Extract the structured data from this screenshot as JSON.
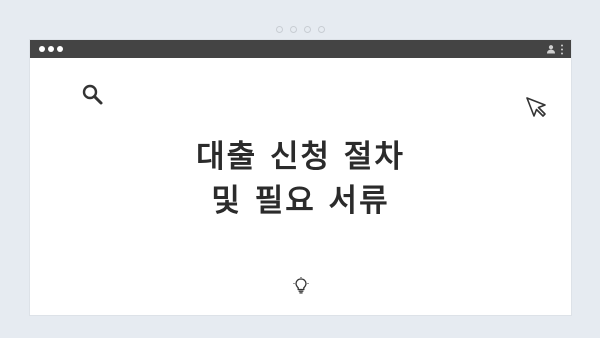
{
  "page": {
    "background_color": "#e6ebf1",
    "window_color": "#ffffff",
    "titlebar_color": "#444444"
  },
  "window_controls": {
    "traffic_lights": [
      "dot",
      "dot",
      "dot"
    ],
    "right_icons": [
      "profile-icon",
      "kebab-menu-icon"
    ]
  },
  "content": {
    "headline_line1": "대출 신청 절차",
    "headline_line2": "및 필요 서류",
    "icons": [
      "search-icon",
      "cursor-icon",
      "lightbulb-icon"
    ]
  }
}
